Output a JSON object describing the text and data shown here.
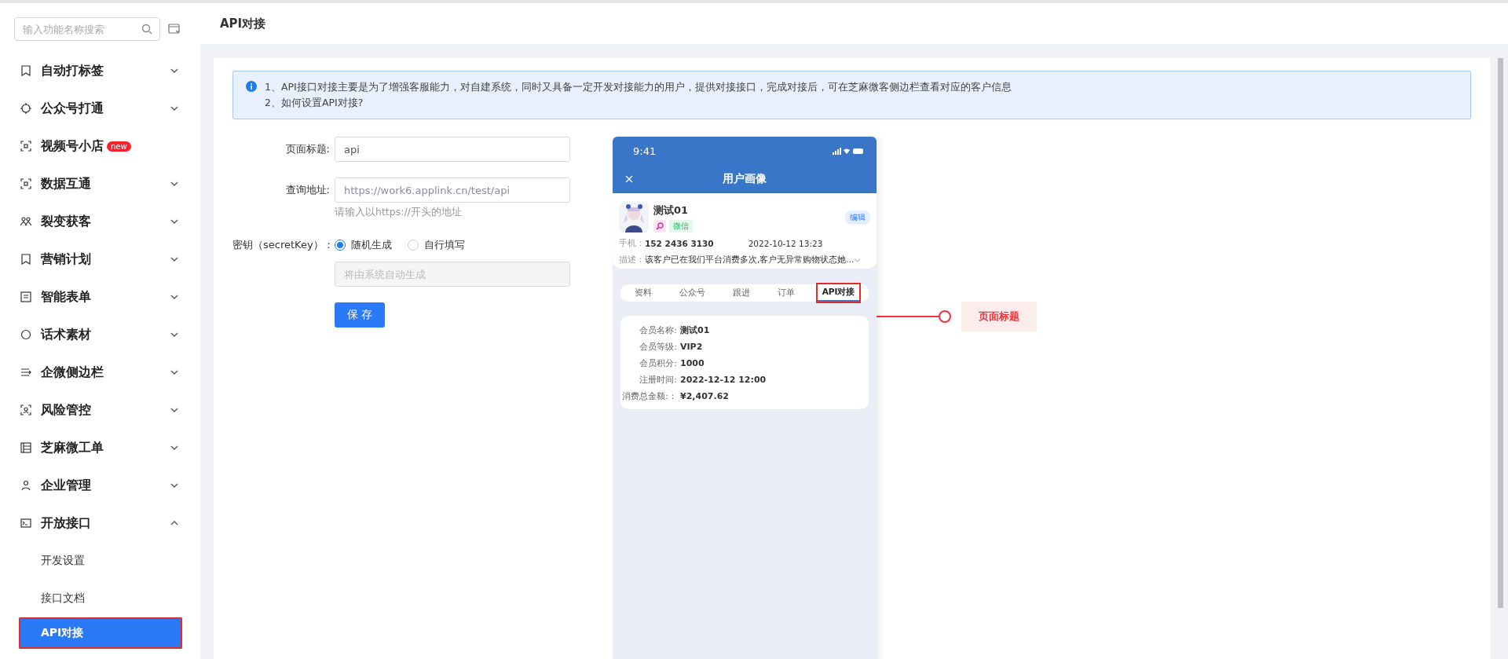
{
  "sidebar": {
    "search": {
      "placeholder": "输入功能名称搜索"
    },
    "items": [
      {
        "label": "自动打标签",
        "expanded": false
      },
      {
        "label": "公众号打通",
        "expanded": false
      },
      {
        "label": "视频号小店",
        "badge": "new"
      },
      {
        "label": "数据互通",
        "expanded": false
      },
      {
        "label": "裂变获客",
        "expanded": false
      },
      {
        "label": "营销计划",
        "expanded": false
      },
      {
        "label": "智能表单",
        "expanded": false
      },
      {
        "label": "话术素材",
        "expanded": false
      },
      {
        "label": "企微侧边栏",
        "expanded": false
      },
      {
        "label": "风险管控",
        "expanded": false
      },
      {
        "label": "芝麻微工单",
        "expanded": false
      },
      {
        "label": "企业管理",
        "expanded": false
      },
      {
        "label": "开放接口",
        "expanded": true,
        "children": [
          {
            "label": "开发设置",
            "selected": false
          },
          {
            "label": "接口文档",
            "selected": false
          },
          {
            "label": "API对接",
            "selected": true
          }
        ]
      }
    ]
  },
  "page": {
    "title": "API对接",
    "notice": {
      "lines": [
        "1、API接口对接主要是为了增强客服能力，对自建系统，同时又具备一定开发对接能力的用户，提供对接接口，完成对接后，可在芝麻微客侧边栏查看对应的客户信息",
        "2、如何设置API对接?"
      ]
    },
    "form": {
      "page_title": {
        "label": "页面标题:",
        "value": "api"
      },
      "query_url": {
        "label": "查询地址:",
        "value": "https://work6.applink.cn/test/api",
        "hint": "请输入以https://开头的地址"
      },
      "secret_key": {
        "label": "密钥（secretKey）：",
        "options": [
          {
            "label": "随机生成",
            "selected": true
          },
          {
            "label": "自行填写",
            "selected": false
          }
        ],
        "placeholder": "将由系统自动生成"
      },
      "save": "保 存"
    },
    "phone": {
      "time": "9:41",
      "title": "用户画像",
      "name": "测试01",
      "tag": "微信",
      "edit": "编辑",
      "phone_label": "手机：",
      "phone_value": "152  2436  3130",
      "date": "2022-10-12 13:23",
      "desc_label": "描述：",
      "desc": "该客户已在我们平台消费多次,客户无异常购物状态她...",
      "tabs": [
        {
          "label": "资料",
          "selected": false
        },
        {
          "label": "公众号",
          "selected": false
        },
        {
          "label": "跟进",
          "selected": false
        },
        {
          "label": "订单",
          "selected": false
        },
        {
          "label": "API对接",
          "selected": true
        }
      ],
      "fields": [
        {
          "label": "会员名称:",
          "value": "测试01"
        },
        {
          "label": "会员等级:",
          "value": "VIP2"
        },
        {
          "label": "会员积分:",
          "value": "1000"
        },
        {
          "label": "注册时间:",
          "value": "2022-12-12 12:00"
        },
        {
          "label": "消费总金额:：",
          "value": "¥2,407.62"
        }
      ]
    },
    "callout": "页面标题"
  }
}
